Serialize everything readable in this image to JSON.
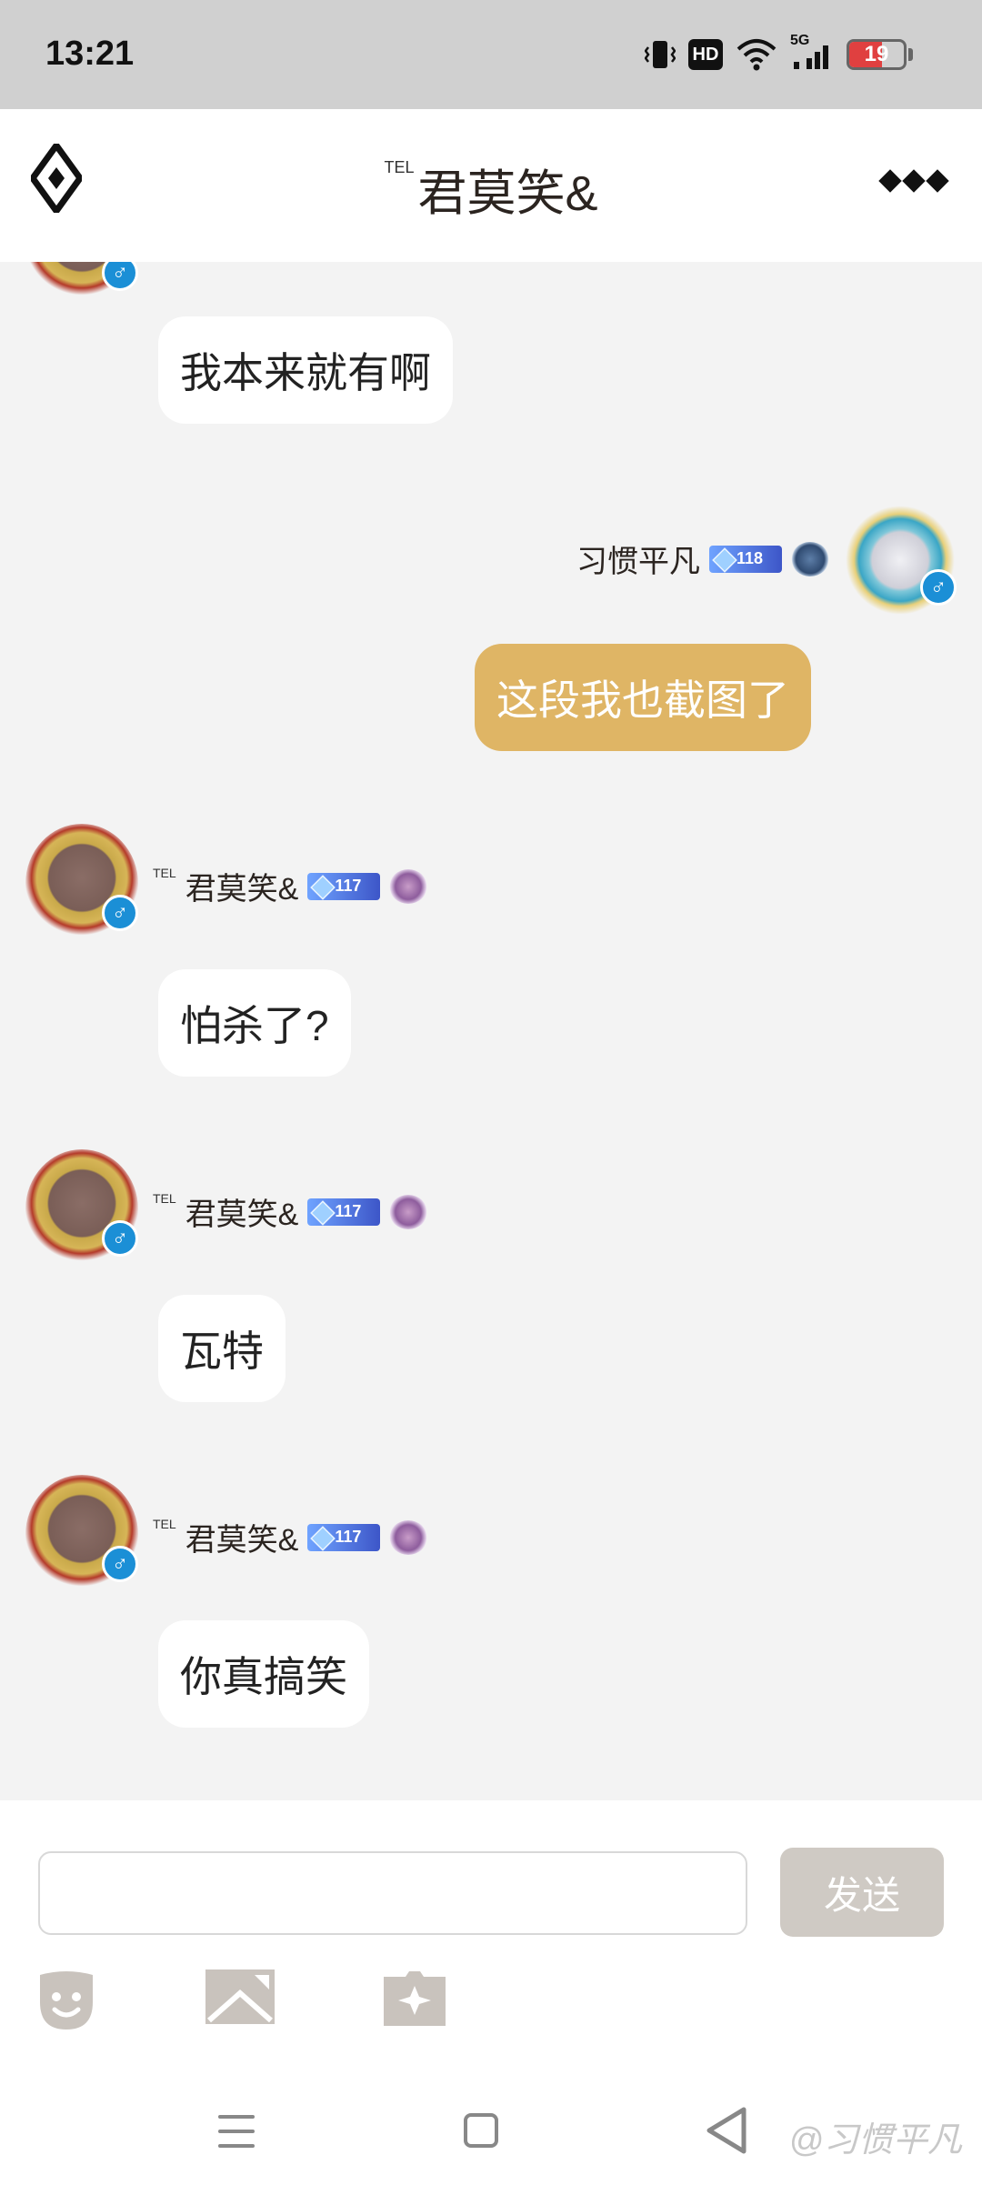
{
  "status_bar": {
    "time": "13:21",
    "hd_label": "HD",
    "network_label": "5G",
    "battery_percent": 19,
    "battery_text": "19",
    "battery_color": "#e04040"
  },
  "header": {
    "title_tag": "TEL",
    "title": "君莫笑&",
    "logo_icon": "diamond-logo-icon",
    "more_icon": "more-dots-icon"
  },
  "messages": [
    {
      "side": "left",
      "text": "我本来就有啊"
    },
    {
      "side": "right",
      "sender_name": "习惯平凡",
      "sender_level": "118",
      "text": "这段我也截图了"
    },
    {
      "side": "left",
      "sender_tag": "TEL",
      "sender_name": "君莫笑&",
      "sender_level": "117",
      "text": "怕杀了?"
    },
    {
      "side": "left",
      "sender_tag": "TEL",
      "sender_name": "君莫笑&",
      "sender_level": "117",
      "text": "瓦特"
    },
    {
      "side": "left",
      "sender_tag": "TEL",
      "sender_name": "君莫笑&",
      "sender_level": "117",
      "text": "你真搞笑"
    }
  ],
  "gender_symbol": "♂",
  "input_bar": {
    "placeholder": "",
    "value": "",
    "send_label": "发送",
    "tools": [
      "emoji-icon",
      "image-icon",
      "sticker-icon"
    ]
  },
  "nav_bar": {
    "watermark": "@习惯平凡"
  },
  "colors": {
    "outgoing_bubble": "#dfb565",
    "incoming_bubble": "#ffffff",
    "send_button": "#cfcac4",
    "gender_badge": "#1b8fd6"
  }
}
